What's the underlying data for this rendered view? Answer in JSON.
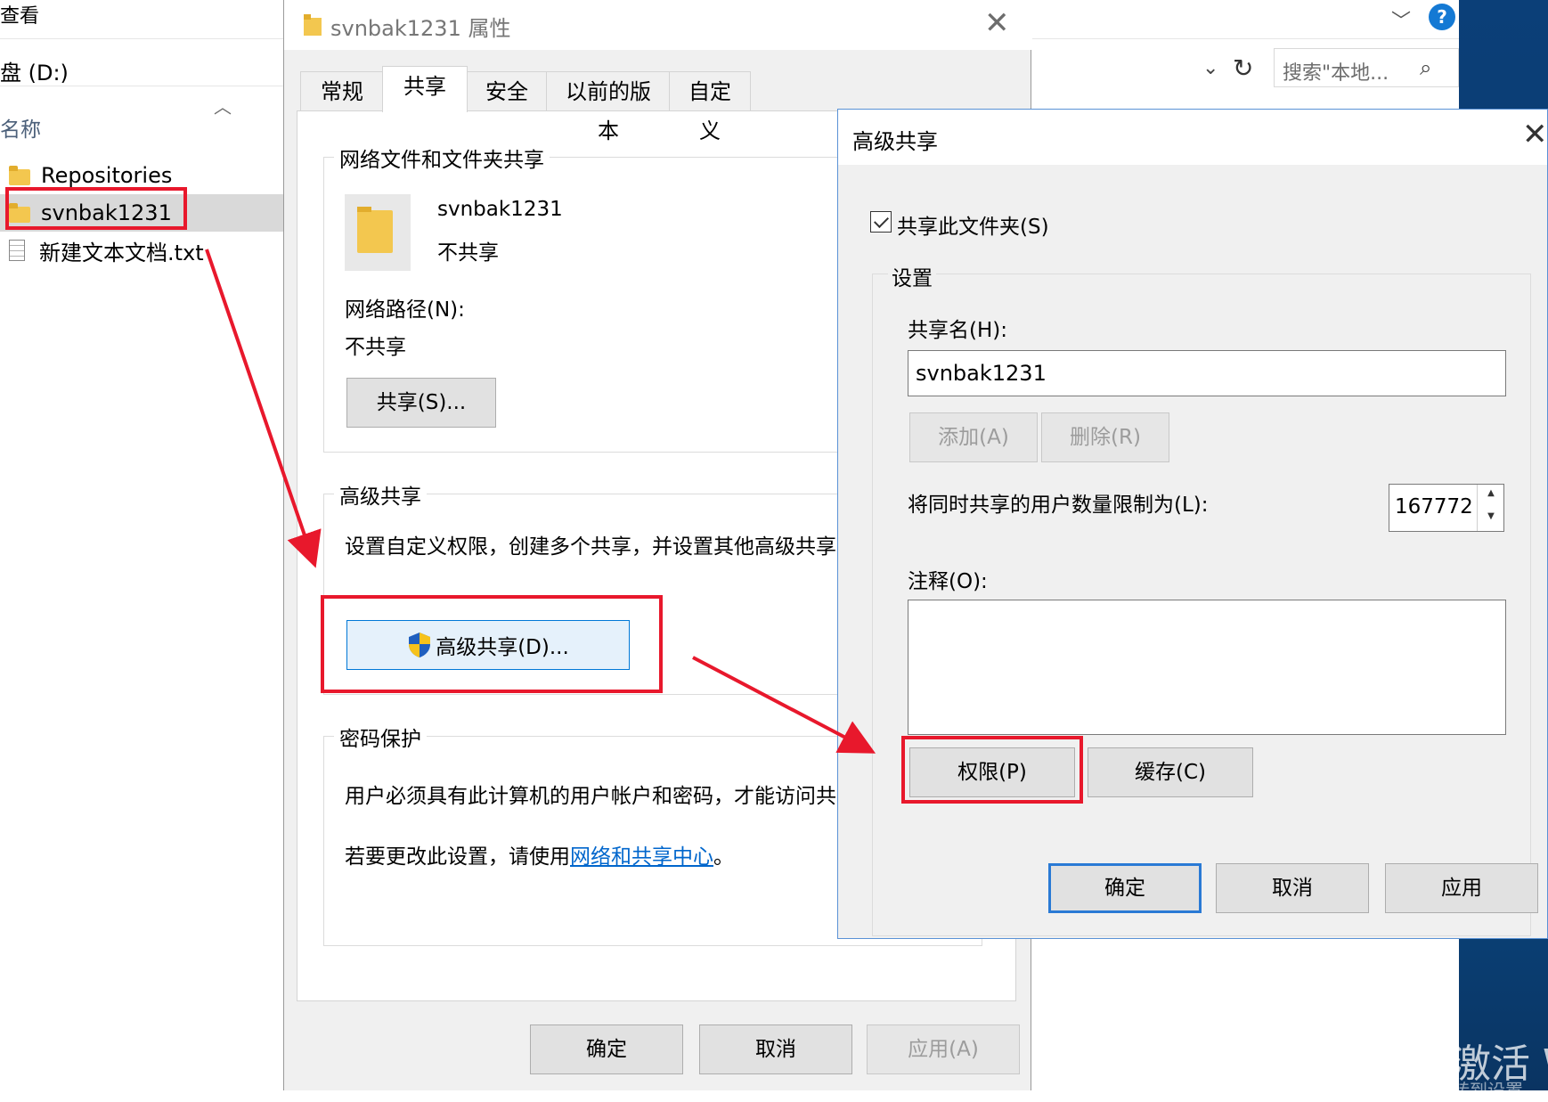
{
  "explorer": {
    "menu_label": "查看",
    "address_label": "盘 (D:)",
    "column_name": "名称",
    "search_placeholder": "搜索\"本地...",
    "files": [
      {
        "name": "Repositories",
        "type": "folder"
      },
      {
        "name": "svnbak1231",
        "type": "folder",
        "selected": true
      },
      {
        "name": "新建文本文档.txt",
        "type": "text"
      }
    ],
    "help_label": "?",
    "watermark": "激活 W",
    "watermark_line2": "转到设置"
  },
  "properties": {
    "title": "svnbak1231 属性",
    "tabs": [
      "常规",
      "共享",
      "安全",
      "以前的版本",
      "自定义"
    ],
    "active_tab": "共享",
    "network_share_group": "网络文件和文件夹共享",
    "folder_name": "svnbak1231",
    "share_status": "不共享",
    "network_path_label": "网络路径(N):",
    "network_path_value": "不共享",
    "share_button": "共享(S)...",
    "advanced_group": "高级共享",
    "advanced_desc": "设置自定义权限，创建多个共享，并设置其他高级共享选项。",
    "advanced_button": "高级共享(D)...",
    "password_group": "密码保护",
    "password_desc": "用户必须具有此计算机的用户帐户和密码，才能访问共享文件夹。",
    "change_prefix": "若要更改此设置，请使用",
    "change_link": "网络和共享中心",
    "change_suffix": "。",
    "ok": "确定",
    "cancel": "取消",
    "apply": "应用(A)"
  },
  "advanced_sharing": {
    "title": "高级共享",
    "share_checkbox_label": "共享此文件夹(S)",
    "share_checked": true,
    "settings_group": "设置",
    "share_name_label": "共享名(H):",
    "share_name_value": "svnbak1231",
    "add_button": "添加(A)",
    "remove_button": "删除(R)",
    "limit_label": "将同时共享的用户数量限制为(L):",
    "limit_value": "167772",
    "comment_label": "注释(O):",
    "comment_value": "",
    "permissions_button": "权限(P)",
    "caching_button": "缓存(C)",
    "ok": "确定",
    "cancel": "取消",
    "apply": "应用"
  },
  "annotations": {
    "highlight_color": "#e8182c",
    "accent_color": "#0078d7"
  }
}
